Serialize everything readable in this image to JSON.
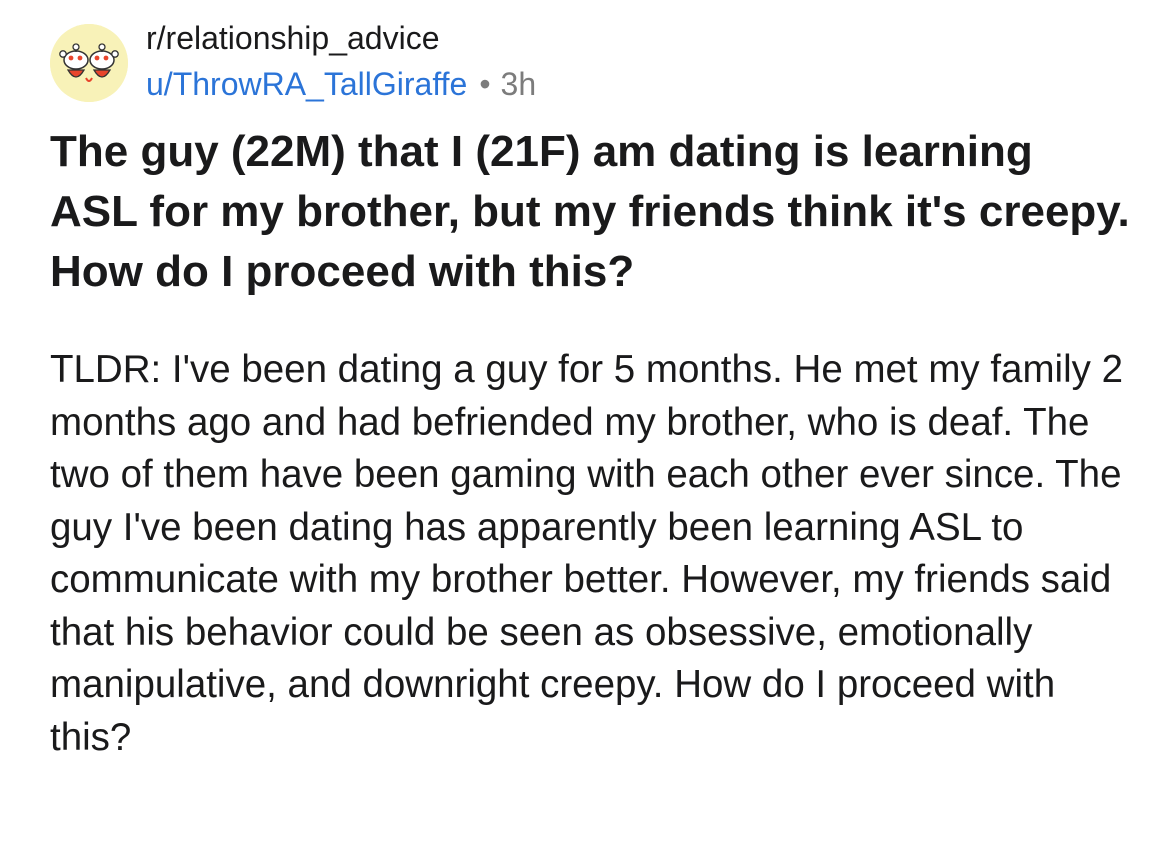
{
  "post": {
    "subreddit": "r/relationship_advice",
    "username": "u/ThrowRA_TallGiraffe",
    "separator": "•",
    "time": "3h",
    "avatar_icon": "reddit-snoo-avatar-icon",
    "title": "The guy (22M) that I (21F) am dating is learning ASL for my brother, but my friends think it's creepy. How do I proceed with this?",
    "body": "TLDR: I've been dating a guy for 5 months. He met my family 2 months ago and had befriended my brother, who is deaf. The two of them have been gaming with each other ever since. The guy I've been dating has apparently been learning ASL to communicate with my brother better. However, my friends said that his behavior could be seen as obsessive, emotionally manipulative, and downright creepy. How do I proceed with this?"
  },
  "colors": {
    "text": "#1a1a1b",
    "username": "#2b74d8",
    "muted": "#7c7c7c",
    "avatar_bg": "#f8f2b8",
    "avatar_accent": "#e8452c"
  }
}
